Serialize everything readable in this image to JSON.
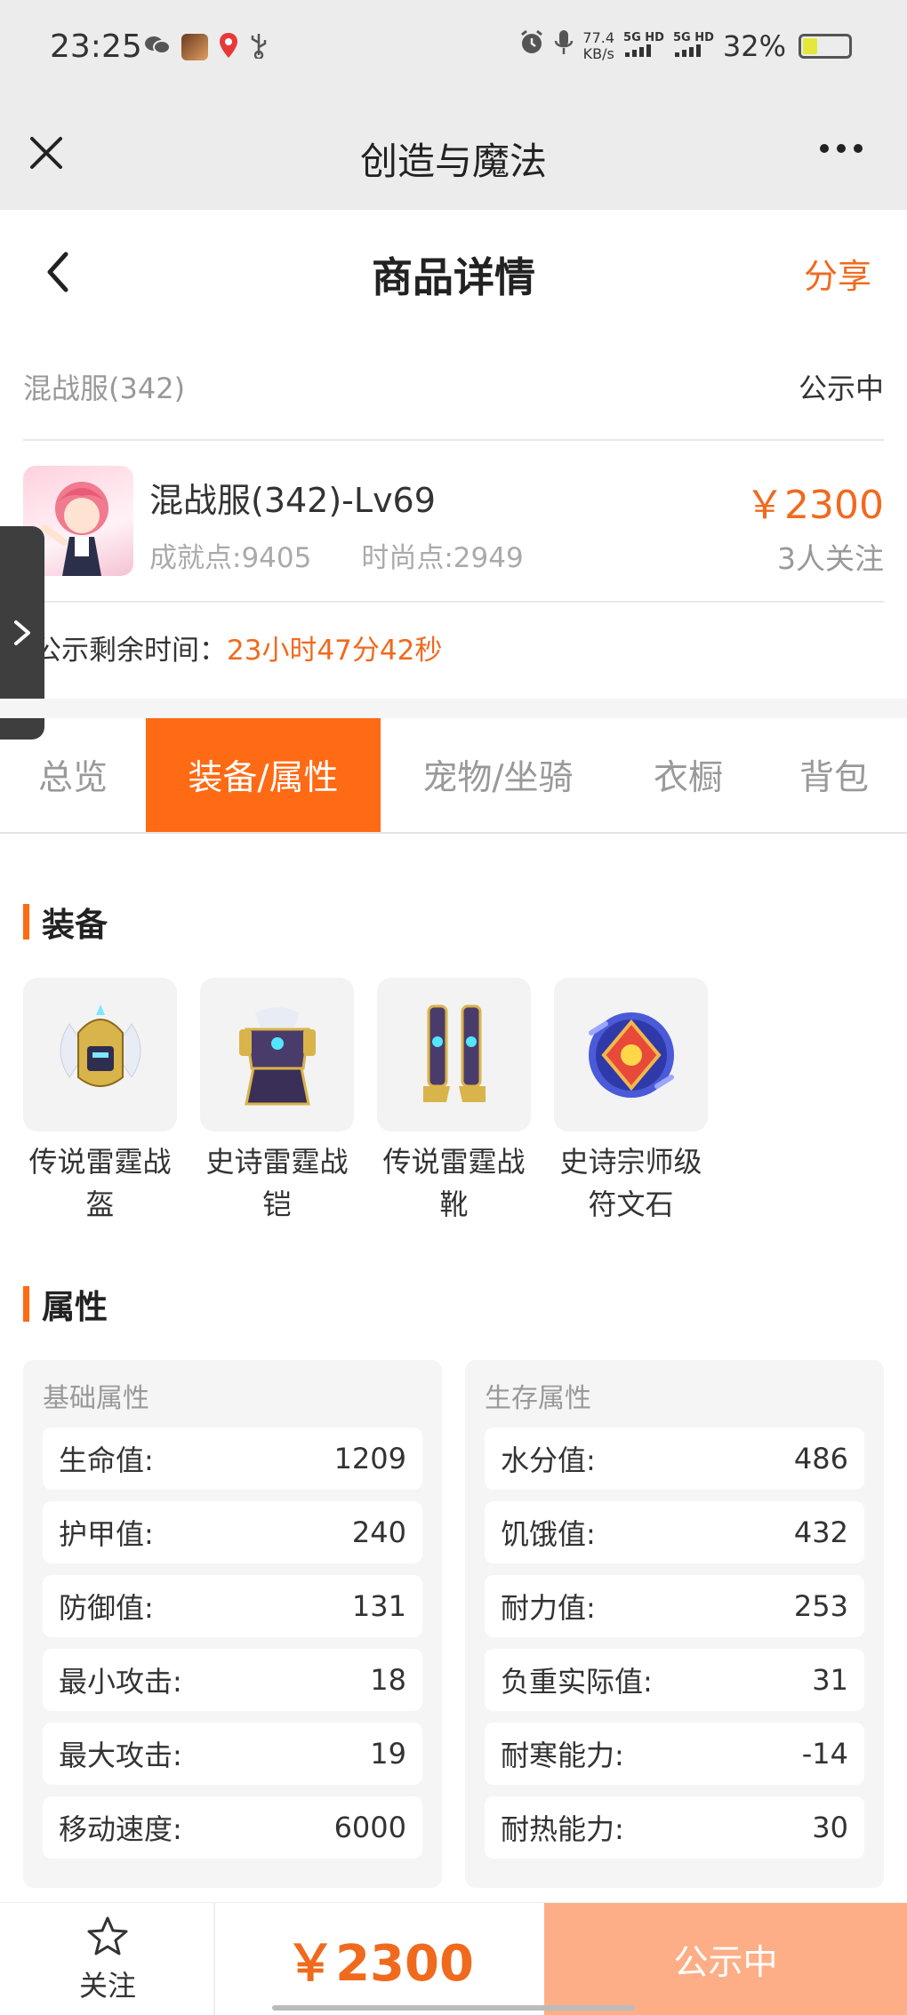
{
  "status_bar": {
    "time": "23:25",
    "net_speed_value": "77.4",
    "net_speed_unit": "KB/s",
    "signal1_label": "5G HD",
    "signal2_label": "5G HD",
    "battery": "32%"
  },
  "app_header": {
    "title": "创造与魔法"
  },
  "page_nav": {
    "title": "商品详情",
    "share_label": "分享"
  },
  "listing": {
    "server": "混战服(342)",
    "status": "公示中",
    "character_name": "混战服(342)-Lv69",
    "achievement_points": "成就点:9405",
    "fashion_points": "时尚点:2949",
    "price": "￥2300",
    "followers": "3人关注",
    "countdown_label": "公示剩余时间：",
    "countdown_value": "23小时47分42秒"
  },
  "tabs": [
    {
      "label": "总览",
      "active": false
    },
    {
      "label": "装备/属性",
      "active": true
    },
    {
      "label": "宠物/坐骑",
      "active": false
    },
    {
      "label": "衣橱",
      "active": false
    },
    {
      "label": "背包",
      "active": false
    }
  ],
  "equipment": {
    "title": "装备",
    "items": [
      {
        "name": "传说雷霆战盔",
        "icon": "helmet-icon"
      },
      {
        "name": "史诗雷霆战铠",
        "icon": "armor-icon"
      },
      {
        "name": "传说雷霆战靴",
        "icon": "boots-icon"
      },
      {
        "name": "史诗宗师级符文石",
        "icon": "rune-stone-icon"
      }
    ]
  },
  "attributes": {
    "title": "属性",
    "basic": {
      "title": "基础属性",
      "rows": [
        {
          "label": "生命值:",
          "value": "1209"
        },
        {
          "label": "护甲值:",
          "value": "240"
        },
        {
          "label": "防御值:",
          "value": "131"
        },
        {
          "label": "最小攻击:",
          "value": "18"
        },
        {
          "label": "最大攻击:",
          "value": "19"
        },
        {
          "label": "移动速度:",
          "value": "6000"
        }
      ]
    },
    "survival": {
      "title": "生存属性",
      "rows": [
        {
          "label": "水分值:",
          "value": "486"
        },
        {
          "label": "饥饿值:",
          "value": "432"
        },
        {
          "label": "耐力值:",
          "value": "253"
        },
        {
          "label": "负重实际值:",
          "value": "31"
        },
        {
          "label": "耐寒能力:",
          "value": "-14"
        },
        {
          "label": "耐热能力:",
          "value": "30"
        }
      ]
    }
  },
  "bottom_bar": {
    "follow_label": "关注",
    "price": "￥2300",
    "action_label": "公示中"
  },
  "colors": {
    "accent": "#ff6a14",
    "price": "#f06a1e",
    "buy_button": "#fdae86"
  }
}
